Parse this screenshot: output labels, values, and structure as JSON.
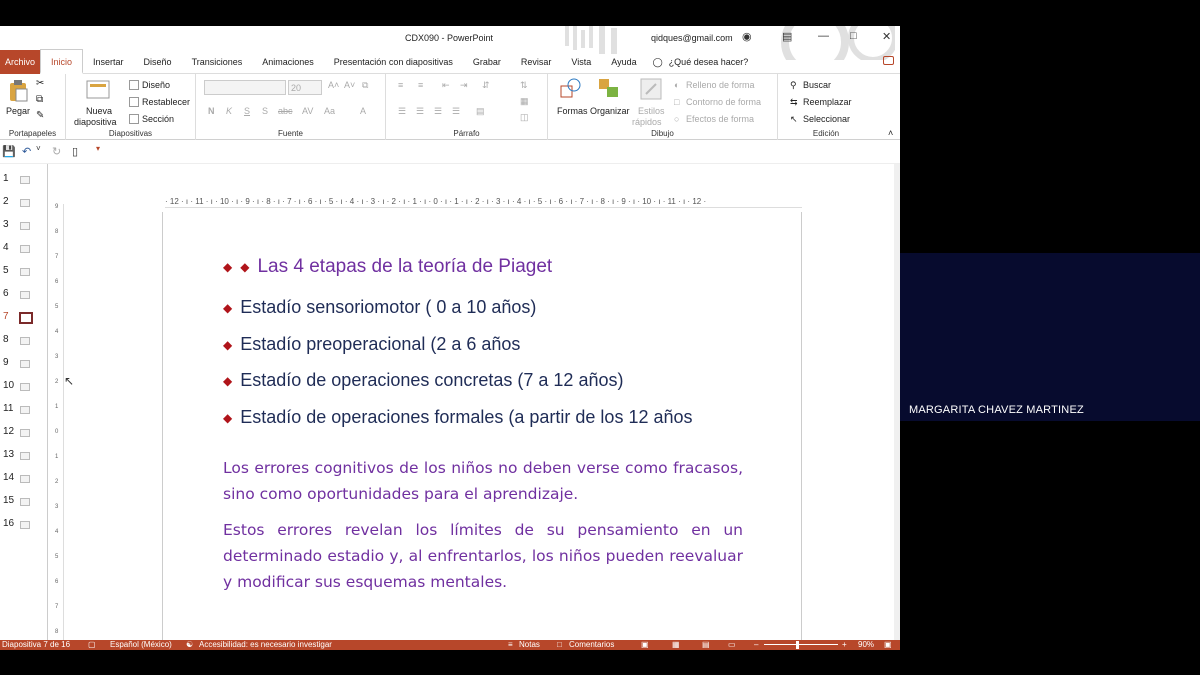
{
  "window": {
    "doc_title": "CDX090  -  PowerPoint",
    "account": "qidques@gmail.com"
  },
  "tabs": [
    "Archivo",
    "Inicio",
    "Insertar",
    "Diseño",
    "Transiciones",
    "Animaciones",
    "Presentación con diapositivas",
    "Grabar",
    "Revisar",
    "Vista",
    "Ayuda"
  ],
  "tell_me": "¿Qué desea hacer?",
  "ribbon": {
    "portapapeles": {
      "label": "Portapapeles",
      "paste": "Pegar"
    },
    "diapositivas": {
      "label": "Diapositivas",
      "new_slide_1": "Nueva",
      "new_slide_2": "diapositiva",
      "layout": "Diseño",
      "reset": "Restablecer",
      "section": "Sección"
    },
    "fuente": {
      "label": "Fuente",
      "size": "20"
    },
    "parrafo": {
      "label": "Párrafo"
    },
    "dibujo": {
      "label": "Dibujo",
      "shapes": "Formas",
      "arrange": "Organizar",
      "styles_1": "Estilos",
      "styles_2": "rápidos",
      "fill": "Relleno de forma",
      "outline": "Contorno de forma",
      "effects": "Efectos de forma"
    },
    "edicion": {
      "label": "Edición",
      "find": "Buscar",
      "replace": "Reemplazar",
      "select": "Seleccionar"
    }
  },
  "thumbnails": [
    "1",
    "2",
    "3",
    "4",
    "5",
    "6",
    "7",
    "8",
    "9",
    "10",
    "11",
    "12",
    "13",
    "14",
    "15",
    "16"
  ],
  "selected_slide": "7",
  "ruler_ticks": "· 12 · ı · 11 · ı · 10 · ı · 9 · ı · 8 · ı · 7 · ı · 6 · ı · 5 · ı · 4 · ı · 3 · ı · 2 · ı · 1 · ı · 0 · ı · 1 · ı · 2 · ı · 3 · ı · 4 · ı · 5 · ı · 6 · ı · 7 · ı · 8 · ı · 9 · ı · 10 · ı · 11 · ı · 12 ·",
  "vruler_ticks": [
    "9",
    "8",
    "7",
    "6",
    "5",
    "4",
    "3",
    "2",
    "1",
    "0",
    "1",
    "2",
    "3",
    "4",
    "5",
    "6",
    "7",
    "8"
  ],
  "slide": {
    "title": "Las 4 etapas de la teoría de Piaget",
    "bullets": [
      "Estadío sensoriomotor ( 0 a 10 años)",
      "Estadío preoperacional (2 a 6 años",
      "Estadío de operaciones concretas (7 a 12 años)",
      "Estadío de operaciones formales (a partir de los 12 años"
    ],
    "paragraph_1": "Los errores cognitivos de los niños no deben verse como fracasos, sino como oportunidades para el aprendizaje.",
    "paragraph_2": "Estos errores revelan los límites de su pensamiento en un determinado estadio y, al enfrentarlos, los niños pueden reevaluar y modificar sus esquemas mentales."
  },
  "status": {
    "slide_count": "Diapositiva 7 de 16",
    "language": "Español (México)",
    "accessibility": "Accesibilidad: es necesario investigar",
    "notes": "Notas",
    "comments": "Comentarios",
    "zoom": "90%"
  },
  "participant": {
    "name": "MARGARITA CHAVEZ MARTINEZ"
  },
  "colors": {
    "accent": "#b7472a",
    "title_purple": "#7030a0",
    "bullet_navy": "#1f2c56",
    "bullet_red": "#b0141a",
    "tile_bg": "#070b2e"
  }
}
